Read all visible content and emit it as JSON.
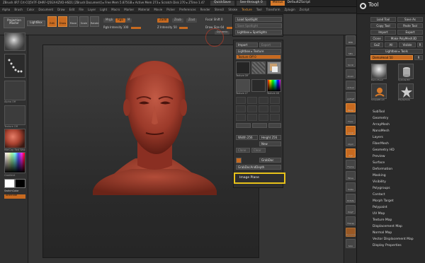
{
  "titlebar": {
    "title": "ZBrush 4R7   Crt-CQ5V7F-DHRF-Q5GX-KZVD-HSD1   [ZBrush Document]   ▸ Free Mem 5.875GB ▸ Active Mem 273 ▸ Scratch Disk 270 ▸ ZTime 1.47",
    "quicksave": "QuickSave",
    "seethrough": "See-through  0",
    "menus": "Menus",
    "default_script": "DefaultZScript"
  },
  "menubar": [
    "Alpha",
    "Brush",
    "Color",
    "Document",
    "Draw",
    "Edit",
    "File",
    "Layer",
    "Light",
    "Macro",
    "Marker",
    "Material",
    "Movie",
    "Picker",
    "Preferences",
    "Render",
    "Stencil",
    "Stroke",
    "Texture",
    "Tool",
    "Transform",
    "Zplugin",
    "Zscript"
  ],
  "menubar_active": "Texture",
  "shelf": {
    "projection_master": "Projection Master",
    "lightbox": "LightBox",
    "buttons": [
      {
        "label": "Edit",
        "on": true
      },
      {
        "label": "Draw",
        "on": true
      },
      {
        "label": "Move",
        "on": false
      },
      {
        "label": "Scale",
        "on": false
      },
      {
        "label": "Rotate",
        "on": false
      }
    ],
    "mrgb": "Mrgb",
    "rgb": "Rgb",
    "m": "M",
    "zadd": "Zadd",
    "zsub": "Zsub",
    "zcut": "Zcut",
    "rgb_intensity_label": "Rgb Intensity",
    "rgb_intensity_value": "100",
    "z_intensity_label": "Z Intensity",
    "z_intensity_value": "50",
    "focal_shift_label": "Focal Shift",
    "focal_shift_value": "0",
    "draw_size_label": "Draw Size",
    "draw_size_value": "64",
    "dynamic": "Dynamic"
  },
  "leftpanel": {
    "labels": [
      "Alpha Off",
      "Texture Off",
      "MatCap Red Wax"
    ],
    "gradient": "Gradient",
    "switchcolor": "SwitchColor",
    "alternate": "Alternate"
  },
  "popup1": {
    "load_spotlight": "Load Spotlight",
    "save_spotlight": "Save Spotlight",
    "lightbox_spotlights": "Lightbox ▸ Spotlights"
  },
  "popup2": {
    "import": "Import",
    "export": "Export",
    "lightbox_texture": "Lightbox ▸ Texture",
    "texture_off": "Texture Off",
    "texture_off_value": "0",
    "tex_labels": [
      "Texture Off",
      "Texture 27",
      "Texture 27",
      "Texture 46"
    ],
    "width_label": "Width",
    "width_value": "256",
    "height_label": "Height",
    "height_value": "256",
    "new": "New",
    "clone": "Clone",
    "clear": "Clear",
    "grabdoc": "GrabDoc",
    "grabdoc_depth": "GrabDocAndDepth",
    "image_plane": "Image Plane"
  },
  "toolpal": {
    "title": "Tool",
    "load_tool": "Load Tool",
    "save_as": "Save As",
    "copy_tool": "Copy Tool",
    "paste_tool": "Paste Tool",
    "import": "Import",
    "export": "Export",
    "clone": "Clone",
    "make_polymesh": "Make PolyMesh3D",
    "goz": "GoZ",
    "all": "All",
    "visible": "Visible",
    "r": "R",
    "lightbox_tools": "Lightbox ▸ Tools",
    "demohead": "DemoHead",
    "demohead_value": "50",
    "tool_thumbs": [
      "DemoHead",
      "Cylinder3D",
      "SimpleBrush",
      "PolySphere"
    ],
    "list": [
      "SubTool",
      "Geometry",
      "ArrayMesh",
      "NanoMesh",
      "Layers",
      "FiberMesh",
      "Geometry HD",
      "Preview",
      "Surface",
      "Deformation",
      "Masking",
      "Visibility",
      "Polygroups",
      "Contact",
      "Morph Target",
      "Polypaint",
      "UV Map",
      "Texture Map",
      "Displacement Map",
      "Normal Map",
      "Vector Displacement Map",
      "Display Properties"
    ]
  },
  "rightcol": [
    "BPR",
    "SPix",
    "Scroll",
    "Zoom",
    "Actual",
    "AAHalf",
    "Persp",
    "Floor",
    "Local",
    "LSym",
    "Xyz",
    "Frame",
    "Move",
    "Scale",
    "Rotate",
    "PolyF",
    "Transp",
    "Dynamic",
    "Solo"
  ],
  "colors": {
    "accent": "#c76a20",
    "highlight": "#e8c21a",
    "bust": "#a8412f"
  }
}
